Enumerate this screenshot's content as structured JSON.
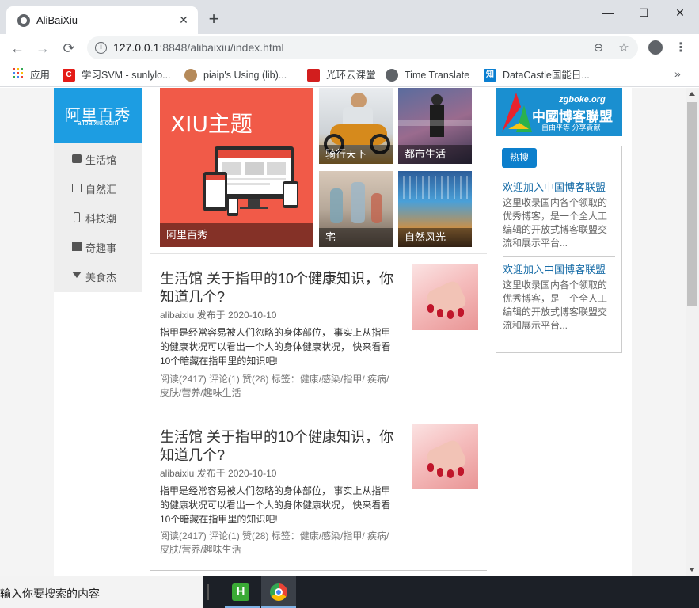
{
  "browser": {
    "tab_title": "AliBaiXiu",
    "tab_close": "✕",
    "new_tab": "+",
    "url_host": "127.0.0.1",
    "url_rest": ":8848/alibaixiu/index.html",
    "window_minimize": "—",
    "window_maximize": "☐",
    "window_close": "✕",
    "back": "←",
    "forward": "→",
    "reload": "⟳",
    "zoom_icon": "⊖",
    "star_icon": "☆",
    "menu": "⋮"
  },
  "bookmarks": [
    {
      "label": "应用",
      "icon": "apps-grid-icon"
    },
    {
      "label": "学习SVM - sunlylo...",
      "icon": "c-red-icon",
      "icon_text": "C",
      "color": "#e41b17"
    },
    {
      "label": "piaip's Using (lib)...",
      "icon": "cookie-icon",
      "color": "#b58a5a"
    },
    {
      "label": "光环云课堂",
      "icon": "swirl-red-icon",
      "color": "#d21e1e"
    },
    {
      "label": "Time Translate",
      "icon": "globe-icon",
      "color": "#5f6368"
    },
    {
      "label": "DataCastle国能日...",
      "icon": "zhi-blue-icon",
      "icon_text": "知",
      "color": "#0a7fd1"
    }
  ],
  "bookmarks_more": "»",
  "site": {
    "logo_main": "阿里百秀",
    "logo_sub": "alibaixiu.com",
    "nav": [
      "生活馆",
      "自然汇",
      "科技潮",
      "奇趣事",
      "美食杰"
    ]
  },
  "features": {
    "main_headline": "XIU主题",
    "main_caption": "阿里百秀",
    "tiles": [
      "骑行天下",
      "都市生活",
      "宅",
      "自然风光"
    ]
  },
  "articles": [
    {
      "title": "生活馆 关于指甲的10个健康知识，你知道几个?",
      "meta": "alibaixiu 发布于 2020-10-10",
      "desc": "指甲是经常容易被人们忽略的身体部位， 事实上从指甲的健康状况可以看出一个人的身体健康状况， 快来看看10个暗藏在指甲里的知识吧!",
      "stats": "阅读(2417) 评论(1) 赞(28) 标签：健康/感染/指甲/ 疾病/皮肤/营养/趣味生活"
    },
    {
      "title": "生活馆 关于指甲的10个健康知识，你知道几个?",
      "meta": "alibaixiu 发布于 2020-10-10",
      "desc": "指甲是经常容易被人们忽略的身体部位， 事实上从指甲的健康状况可以看出一个人的身体健康状况， 快来看看10个暗藏在指甲里的知识吧!",
      "stats": "阅读(2417) 评论(1) 赞(28) 标签：健康/感染/指甲/ 疾病/皮肤/营养/趣味生活"
    }
  ],
  "sidebar": {
    "banner_site": "zgboke.org",
    "banner_name": "中國博客聯盟",
    "banner_slogan": "自由平等 分享責献",
    "hot_label": "热搜",
    "hot_items": [
      {
        "link": "欢迎加入中国博客联盟",
        "desc": "这里收录国内各个领取的优秀博客，是一个全人工编辑的开放式博客联盟交流和展示平台..."
      },
      {
        "link": "欢迎加入中国博客联盟",
        "desc": "这里收录国内各个领取的优秀博客，是一个全人工编辑的开放式博客联盟交流和展示平台..."
      }
    ]
  },
  "taskbar": {
    "search_text": "输入你要搜索的内容",
    "apps": [
      "hbuilder-icon",
      "chrome-icon"
    ]
  }
}
